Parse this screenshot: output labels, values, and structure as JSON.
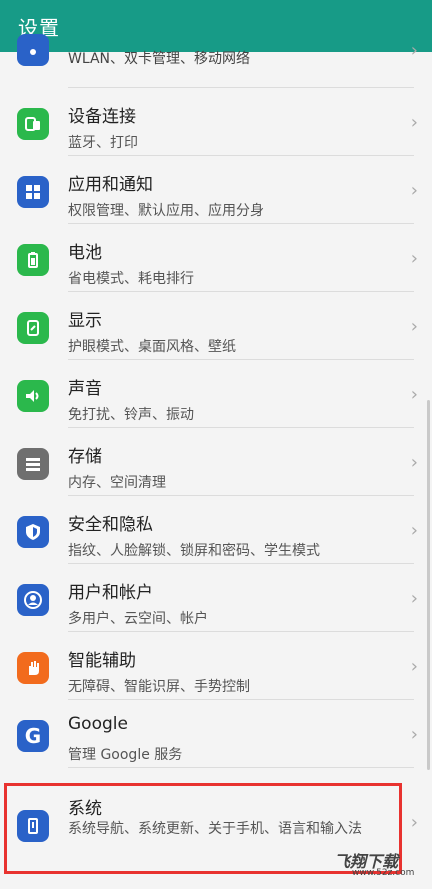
{
  "header": {
    "title": "设置"
  },
  "items": [
    {
      "title": "",
      "sub": "WLAN、双卡管理、移动网络",
      "color": "#2a62c8",
      "icon": "wifi-icon"
    },
    {
      "title": "设备连接",
      "sub": "蓝牙、打印",
      "color": "#2bb84c",
      "icon": "device-connect-icon"
    },
    {
      "title": "应用和通知",
      "sub": "权限管理、默认应用、应用分身",
      "color": "#2a62c8",
      "icon": "apps-icon"
    },
    {
      "title": "电池",
      "sub": "省电模式、耗电排行",
      "color": "#2bb84c",
      "icon": "battery-icon"
    },
    {
      "title": "显示",
      "sub": "护眼模式、桌面风格、壁纸",
      "color": "#2bb84c",
      "icon": "display-icon"
    },
    {
      "title": "声音",
      "sub": "免打扰、铃声、振动",
      "color": "#2bb84c",
      "icon": "sound-icon"
    },
    {
      "title": "存储",
      "sub": "内存、空间清理",
      "color": "#6f6f6f",
      "icon": "storage-icon"
    },
    {
      "title": "安全和隐私",
      "sub": "指纹、人脸解锁、锁屏和密码、学生模式",
      "color": "#2a62c8",
      "icon": "shield-icon"
    },
    {
      "title": "用户和帐户",
      "sub": "多用户、云空间、帐户",
      "color": "#2a62c8",
      "icon": "user-icon"
    },
    {
      "title": "智能辅助",
      "sub": "无障碍、智能识屏、手势控制",
      "color": "#f26b1d",
      "icon": "hand-icon"
    },
    {
      "title": "Google",
      "sub": "管理 Google 服务",
      "color": "#2a62c8",
      "icon": "google-icon"
    },
    {
      "title": "系统",
      "sub": "系统导航、系统更新、关于手机、语言和输入法",
      "color": "#2a62c8",
      "icon": "system-icon"
    }
  ],
  "watermark": {
    "text": "飞翔下载",
    "url": "www.52z.com"
  }
}
